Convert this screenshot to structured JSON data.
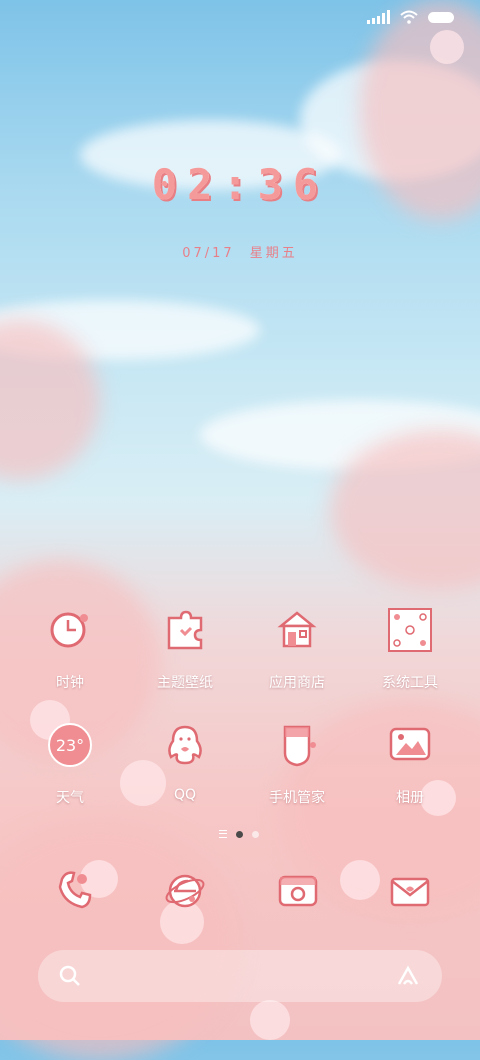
{
  "status_bar": {
    "signal_icon": "signal-icon",
    "wifi_icon": "wifi-icon",
    "battery_icon": "battery-icon"
  },
  "lock_clock": {
    "time": "02:36",
    "date": "07/17",
    "weekday": "星期五"
  },
  "apps_row1": [
    {
      "label": "时钟",
      "icon": "clock-icon"
    },
    {
      "label": "主题壁纸",
      "icon": "puzzle-icon"
    },
    {
      "label": "应用商店",
      "icon": "house-icon"
    },
    {
      "label": "系统工具",
      "icon": "tools-folder-icon"
    }
  ],
  "apps_row2": [
    {
      "label": "天气",
      "icon": "weather-icon",
      "temperature": "23°"
    },
    {
      "label": "QQ",
      "icon": "qq-penguin-icon"
    },
    {
      "label": "手机管家",
      "icon": "shield-icon"
    },
    {
      "label": "相册",
      "icon": "photo-icon"
    }
  ],
  "page_indicator": {
    "total": 2,
    "active": 0
  },
  "dock": [
    {
      "name": "phone",
      "icon": "phone-icon"
    },
    {
      "name": "browser",
      "icon": "browser-icon"
    },
    {
      "name": "camera",
      "icon": "camera-icon"
    },
    {
      "name": "messages",
      "icon": "envelope-icon"
    }
  ],
  "search": {
    "search_icon": "search-icon",
    "assistant_icon": "assistant-icon"
  },
  "colors": {
    "accent": "#f08d92",
    "line": "#e06a72",
    "label": "#ffffff"
  }
}
